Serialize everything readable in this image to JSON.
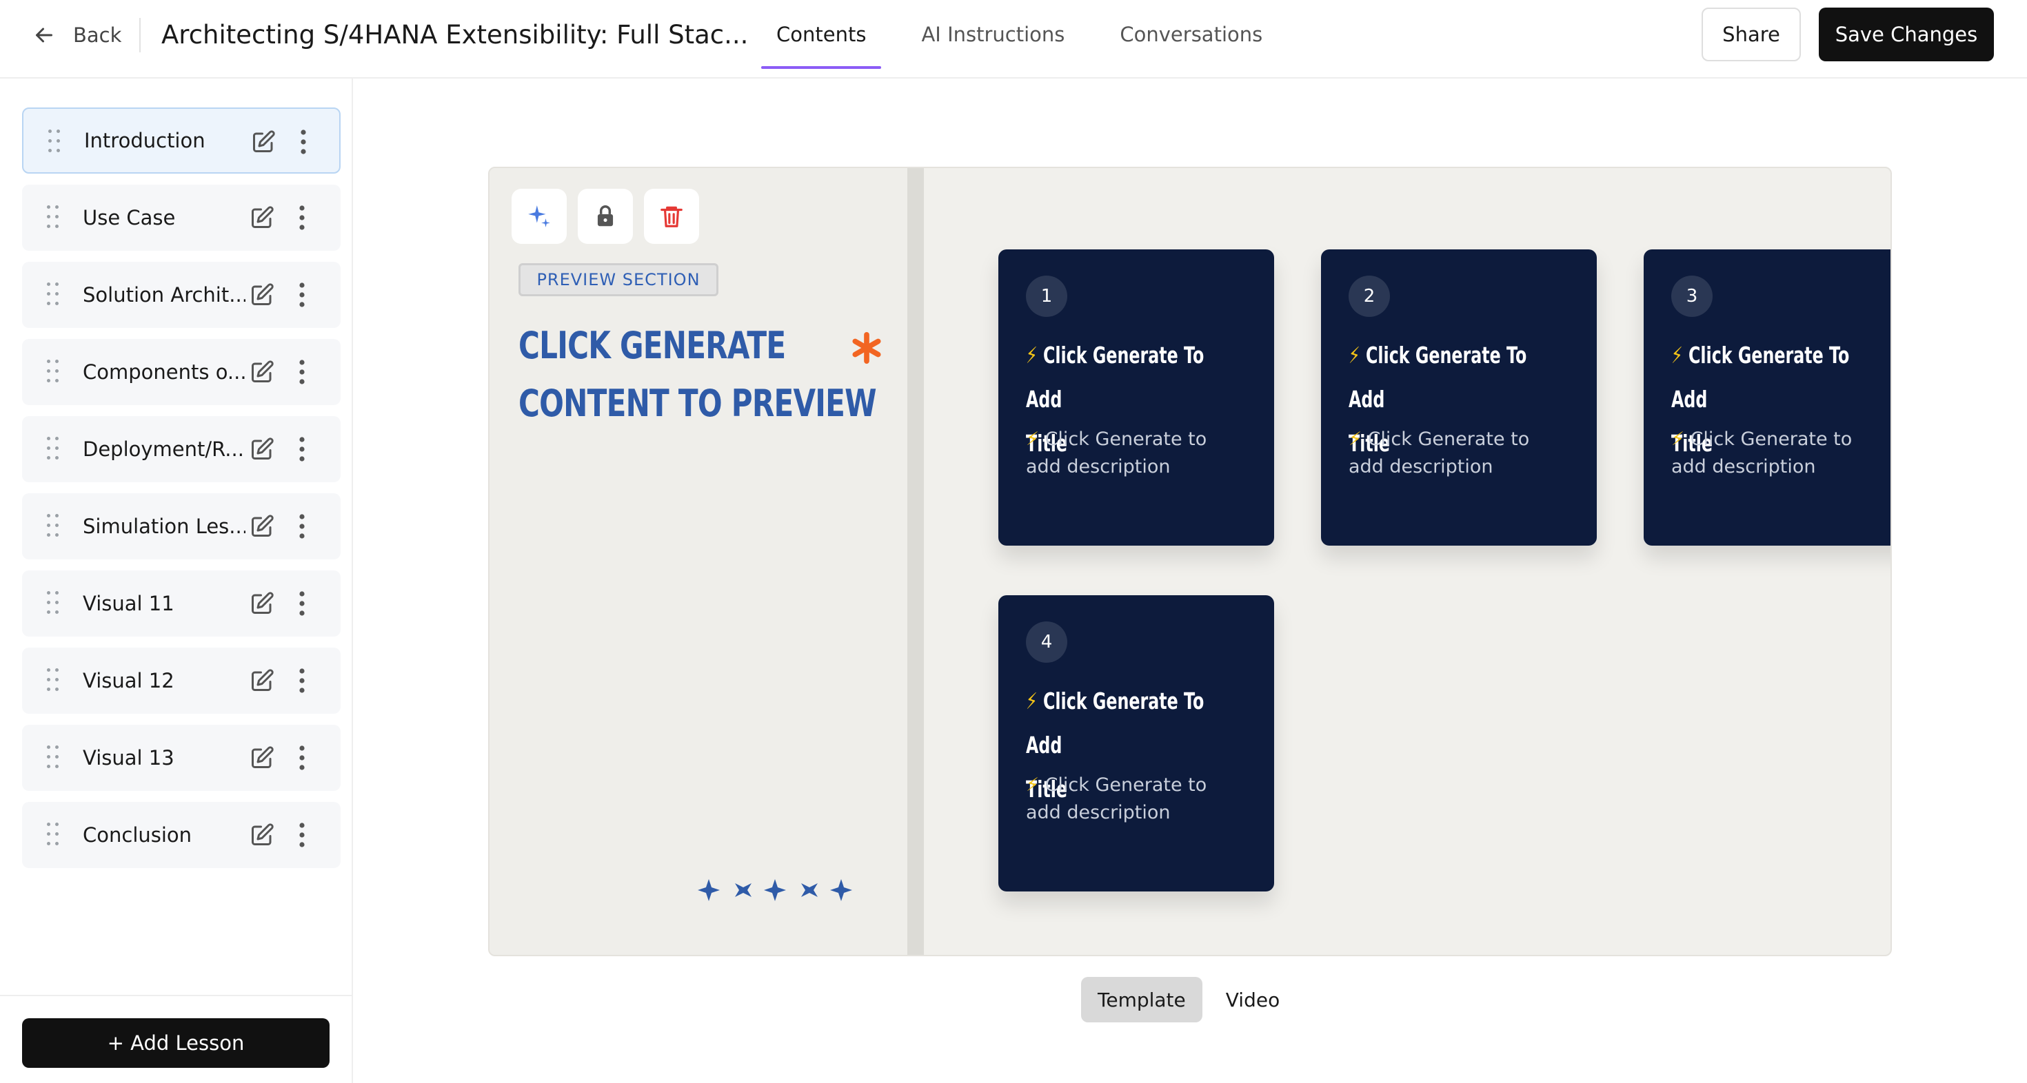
{
  "header": {
    "back_label": "Back",
    "course_title": "Architecting S/4HANA Extensibility: Full Stac...",
    "tabs": [
      {
        "label": "Contents",
        "active": true
      },
      {
        "label": "AI Instructions",
        "active": false
      },
      {
        "label": "Conversations",
        "active": false
      }
    ],
    "share_label": "Share",
    "save_label": "Save Changes"
  },
  "sidebar": {
    "lessons": [
      {
        "label": "Introduction",
        "active": true
      },
      {
        "label": "Use Case"
      },
      {
        "label": "Solution Archit..."
      },
      {
        "label": "Components o..."
      },
      {
        "label": "Deployment/R..."
      },
      {
        "label": "Simulation Les..."
      },
      {
        "label": "Visual 11"
      },
      {
        "label": "Visual 12"
      },
      {
        "label": "Visual 13"
      },
      {
        "label": "Conclusion"
      }
    ],
    "add_lesson_label": "+ Add Lesson"
  },
  "preview": {
    "tag": "PREVIEW SECTION",
    "headline_line1": "CLICK GENERATE",
    "headline_line2": "CONTENT TO PREVIEW",
    "cards": [
      {
        "number": "1",
        "title_line1": "Click Generate To Add",
        "title_line2": "Title",
        "desc": "Click Generate to add description"
      },
      {
        "number": "2",
        "title_line1": "Click Generate To Add",
        "title_line2": "Title",
        "desc": "Click Generate to add description"
      },
      {
        "number": "3",
        "title_line1": "Click Generate To Add",
        "title_line2": "Title",
        "desc": "Click Generate to add description"
      },
      {
        "number": "4",
        "title_line1": "Click Generate To Add",
        "title_line2": "Title",
        "desc": "Click Generate to add description"
      }
    ],
    "bolt_glyph": "⚡",
    "colors": {
      "card_bg": "#0d1b3c",
      "headline": "#2f5ba8",
      "asterisk": "#f26522",
      "delete": "#e53935",
      "tab_underline": "#8b5cf6"
    }
  },
  "toggle": {
    "options": [
      {
        "label": "Template",
        "active": true
      },
      {
        "label": "Video",
        "active": false
      }
    ]
  }
}
